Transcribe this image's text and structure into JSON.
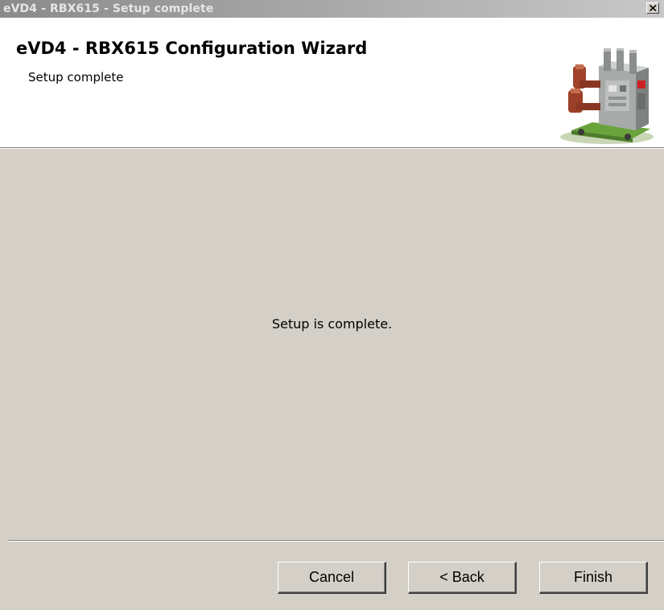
{
  "window": {
    "title": "eVD4 - RBX615 - Setup complete",
    "close_icon": "close-x-icon"
  },
  "header": {
    "title": "eVD4 - RBX615 Configuration Wizard",
    "subtitle": "Setup complete",
    "logo_icon": "circuit-breaker-device-icon"
  },
  "content": {
    "message": "Setup is complete."
  },
  "buttons": {
    "cancel": "Cancel",
    "back": "< Back",
    "finish": "Finish"
  },
  "colors": {
    "dialog_face": "#d4d0c8",
    "header_background": "#ffffff",
    "inactive_title_start": "#8a8a8a",
    "inactive_title_end": "#c8c8c8"
  }
}
